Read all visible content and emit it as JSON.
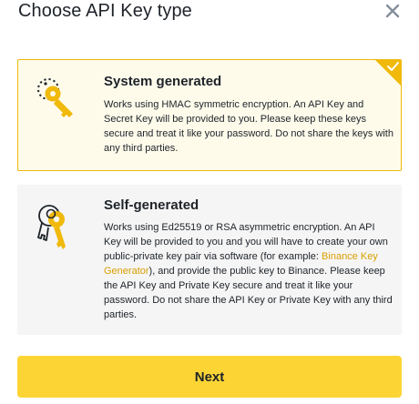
{
  "dialog": {
    "title": "Choose API Key type",
    "close_icon": "close-icon"
  },
  "options": [
    {
      "title": "System generated",
      "description": "Works using HMAC symmetric encryption. An API Key and Secret Key will be provided to you. Please keep these keys secure and treat it like your password. Do not share the keys with any third parties.",
      "icon": "key-icon",
      "selected": true
    },
    {
      "title": "Self-generated",
      "description_before_link": "Works using Ed25519 or RSA asymmetric encryption. An API Key will be provided to you and you will have to create your own public-private key pair via software (for example: ",
      "link_text": "Binance Key Generator",
      "description_after_link": "), and provide the public key to Binance. Please keep the API Key and Private Key secure and treat it like your password. Do not share the API Key or Private Key with any third parties.",
      "icon": "keys-pair-icon",
      "selected": false
    }
  ],
  "next_button": "Next",
  "colors": {
    "accent": "#f0b90b",
    "button": "#fcd535",
    "selected_bg": "#fefbeb",
    "card_bg": "#f5f5f5",
    "link": "#d89f00"
  }
}
